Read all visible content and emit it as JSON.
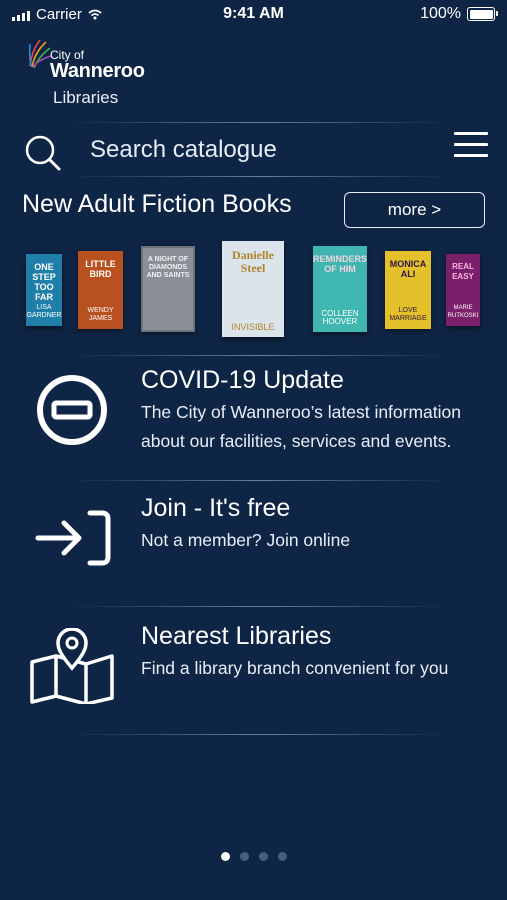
{
  "status": {
    "carrier": "Carrier",
    "time": "9:41 AM",
    "battery": "100%"
  },
  "logo": {
    "city_of": "City of",
    "name": "Wanneroo",
    "sub": "Libraries"
  },
  "search": {
    "placeholder": "Search catalogue"
  },
  "new_books": {
    "title": "New Adult Fiction Books",
    "more_label": "more >",
    "books": [
      {
        "title": "ONE STEP TOO FAR",
        "author": "LISA GARDNER",
        "color": "#1f7fa8"
      },
      {
        "title": "LITTLE BIRD",
        "author": "WENDY JAMES",
        "color": "#b8501f"
      },
      {
        "title": "A NIGHT OF DIAMONDS AND SAINTS",
        "author": "",
        "color": "#8a8f98"
      },
      {
        "title": "Danielle Steel",
        "author": "INVISIBLE",
        "color": "#dbe4ea"
      },
      {
        "title": "REMINDERS OF HIM",
        "author": "COLLEEN HOOVER",
        "color": "#3fb6b0"
      },
      {
        "title": "MONICA ALI",
        "author": "LOVE MARRIAGE",
        "color": "#e4c02a"
      },
      {
        "title": "REAL EASY",
        "author": "MARIE RUTKOSKI",
        "color": "#7a1f6a"
      }
    ]
  },
  "items": [
    {
      "title": "COVID-19 Update",
      "desc": "The City of Wanneroo’s latest information about our facilities, services and events."
    },
    {
      "title": "Join - It's free",
      "desc": "Not a member? Join online"
    },
    {
      "title": "Nearest Libraries",
      "desc": "Find a library branch convenient for you"
    }
  ],
  "pager": {
    "count": 4,
    "active": 0
  }
}
